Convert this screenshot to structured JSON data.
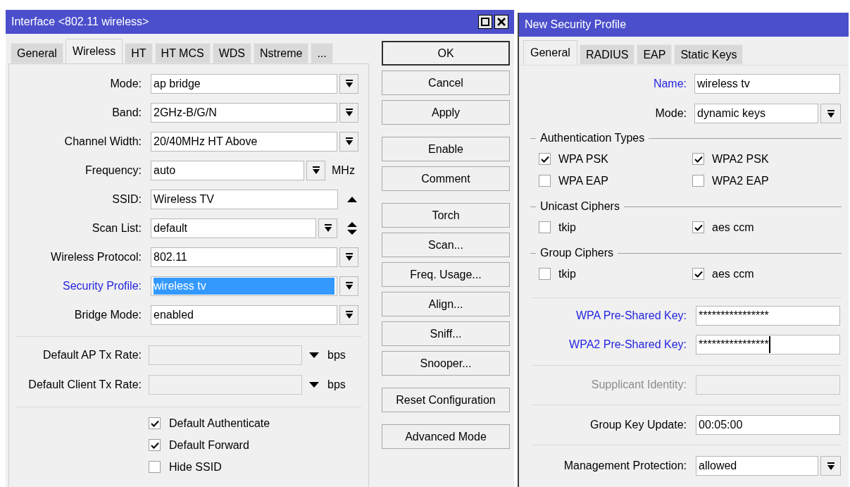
{
  "interface_window": {
    "title": "Interface <802.11 wireless>",
    "tabs": [
      {
        "label": "General",
        "selected": false
      },
      {
        "label": "Wireless",
        "selected": true
      },
      {
        "label": "HT",
        "selected": false
      },
      {
        "label": "HT MCS",
        "selected": false
      },
      {
        "label": "WDS",
        "selected": false
      },
      {
        "label": "Nstreme",
        "selected": false
      },
      {
        "label": "...",
        "selected": false
      }
    ],
    "fields": [
      {
        "kind": "select",
        "label": "Mode:",
        "value": "ap bridge",
        "link": false,
        "highlighted": false
      },
      {
        "kind": "select",
        "label": "Band:",
        "value": "2GHz-B/G/N",
        "link": false,
        "highlighted": false
      },
      {
        "kind": "select",
        "label": "Channel Width:",
        "value": "20/40MHz HT Above",
        "link": false,
        "highlighted": false
      },
      {
        "kind": "select_unit",
        "label": "Frequency:",
        "value": "auto",
        "unit": "MHz",
        "link": false,
        "highlighted": false
      },
      {
        "kind": "text_up",
        "label": "SSID:",
        "value": "Wireless TV",
        "link": false,
        "highlighted": false
      },
      {
        "kind": "select_updown",
        "label": "Scan List:",
        "value": "default",
        "link": false,
        "highlighted": false
      },
      {
        "kind": "select",
        "label": "Wireless Protocol:",
        "value": "802.11",
        "link": false,
        "highlighted": false
      },
      {
        "kind": "select",
        "label": "Security Profile:",
        "value": "wireless tv",
        "link": true,
        "highlighted": true
      },
      {
        "kind": "select",
        "label": "Bridge Mode:",
        "value": "enabled",
        "link": false,
        "highlighted": false
      }
    ],
    "rate_fields": [
      {
        "label": "Default AP Tx Rate:",
        "unit": "bps"
      },
      {
        "label": "Default Client Tx Rate:",
        "unit": "bps"
      }
    ],
    "checkboxes": [
      {
        "label": "Default Authenticate",
        "checked": true
      },
      {
        "label": "Default Forward",
        "checked": true
      },
      {
        "label": "Hide SSID",
        "checked": false
      }
    ],
    "button_groups": [
      [
        {
          "label": "OK",
          "focused": true
        },
        {
          "label": "Cancel",
          "focused": false
        },
        {
          "label": "Apply",
          "focused": false
        }
      ],
      [
        {
          "label": "Enable",
          "focused": false
        },
        {
          "label": "Comment",
          "focused": false
        }
      ],
      [
        {
          "label": "Torch",
          "focused": false
        },
        {
          "label": "Scan...",
          "focused": false
        },
        {
          "label": "Freq. Usage...",
          "focused": false
        },
        {
          "label": "Align...",
          "focused": false
        },
        {
          "label": "Sniff...",
          "focused": false
        },
        {
          "label": "Snooper...",
          "focused": false
        }
      ],
      [
        {
          "label": "Reset Configuration",
          "focused": false
        }
      ],
      [
        {
          "label": "Advanced Mode",
          "focused": false
        }
      ]
    ]
  },
  "security_profile_window": {
    "title": "New Security Profile",
    "tabs": [
      {
        "label": "General",
        "selected": true
      },
      {
        "label": "RADIUS",
        "selected": false
      },
      {
        "label": "EAP",
        "selected": false
      },
      {
        "label": "Static Keys",
        "selected": false
      }
    ],
    "fields": [
      {
        "kind": "text",
        "label": "Name:",
        "value": "wireless tv",
        "link": true
      },
      {
        "kind": "select",
        "label": "Mode:",
        "value": "dynamic keys",
        "link": false
      }
    ],
    "groups": [
      {
        "title": "Authentication Types",
        "options": [
          {
            "label": "WPA PSK",
            "checked": true
          },
          {
            "label": "WPA2 PSK",
            "checked": true
          },
          {
            "label": "WPA EAP",
            "checked": false
          },
          {
            "label": "WPA2 EAP",
            "checked": false
          }
        ]
      },
      {
        "title": "Unicast Ciphers",
        "options": [
          {
            "label": "tkip",
            "checked": false
          },
          {
            "label": "aes ccm",
            "checked": true
          }
        ]
      },
      {
        "title": "Group Ciphers",
        "options": [
          {
            "label": "tkip",
            "checked": false
          },
          {
            "label": "aes ccm",
            "checked": true
          }
        ]
      }
    ],
    "key_fields": [
      {
        "label": "WPA Pre-Shared Key:",
        "value": "****************",
        "link": true,
        "cursor": false
      },
      {
        "label": "WPA2 Pre-Shared Key:",
        "value": "****************",
        "link": true,
        "cursor": true
      }
    ],
    "supplicant": {
      "label": "Supplicant Identity:",
      "disabled": true
    },
    "group_key_update": {
      "label": "Group Key Update:",
      "value": "00:05:00"
    },
    "management_protection": {
      "label": "Management Protection:",
      "value": "allowed"
    }
  }
}
